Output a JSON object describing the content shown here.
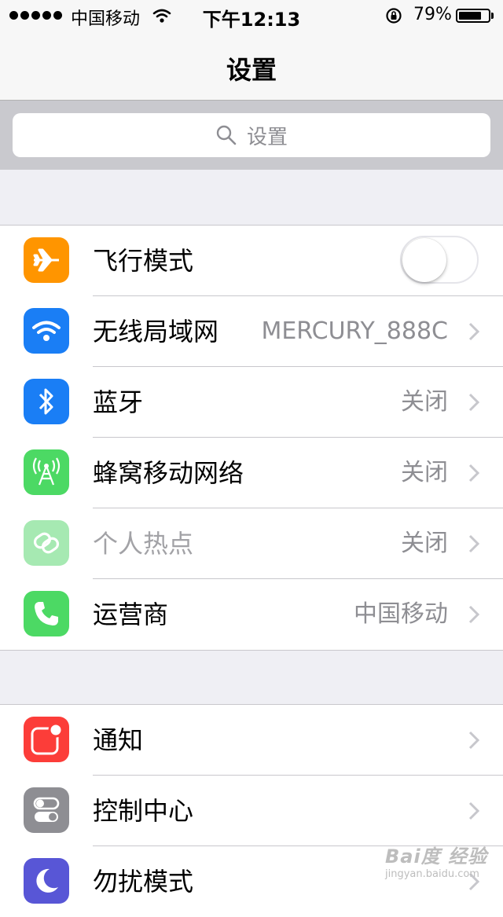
{
  "status_bar": {
    "carrier": "中国移动",
    "time": "下午12:13",
    "battery_percent": "79%",
    "battery_level": 0.79
  },
  "nav": {
    "title": "设置"
  },
  "search": {
    "placeholder": "设置"
  },
  "group1": {
    "airplane": {
      "label": "飞行模式",
      "icon": "airplane-icon",
      "color": "#ff9500",
      "toggle_on": false
    },
    "wifi": {
      "label": "无线局域网",
      "value": "MERCURY_888C",
      "icon": "wifi-icon",
      "color": "#1a7ef5"
    },
    "bluetooth": {
      "label": "蓝牙",
      "value": "关闭",
      "icon": "bluetooth-icon",
      "color": "#1a7ef5"
    },
    "cellular": {
      "label": "蜂窝移动网络",
      "value": "关闭",
      "icon": "cellular-antenna-icon",
      "color": "#4cd964"
    },
    "hotspot": {
      "label": "个人热点",
      "value": "关闭",
      "icon": "hotspot-link-icon",
      "color": "#a6e9b2"
    },
    "carrier": {
      "label": "运营商",
      "value": "中国移动",
      "icon": "phone-icon",
      "color": "#4cd964"
    }
  },
  "group2": {
    "notifications": {
      "label": "通知",
      "icon": "notifications-icon",
      "color": "#fc3d39"
    },
    "control_center": {
      "label": "控制中心",
      "icon": "control-center-icon",
      "color": "#8e8e93"
    },
    "dnd": {
      "label": "勿扰模式",
      "icon": "moon-icon",
      "color": "#5856d6"
    }
  },
  "watermark": {
    "main": "Bai度 经验",
    "sub": "jingyan.baidu.com"
  }
}
